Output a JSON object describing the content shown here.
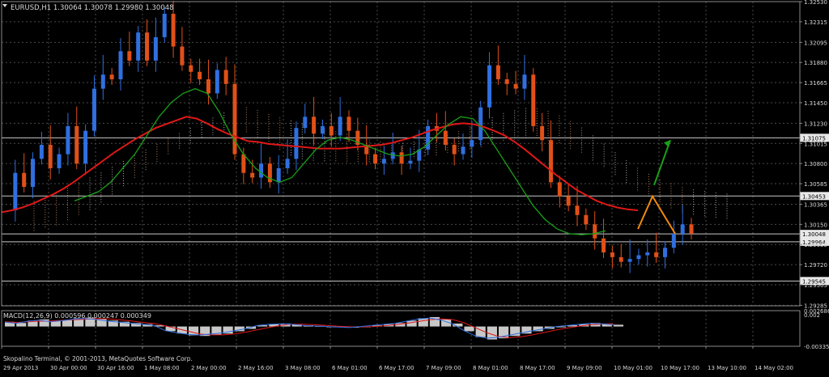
{
  "header": {
    "symbol_info": "EURUSD,H1  1.30064 1.30078 1.29980 1.30048",
    "macd_info": "MACD(12,26,9) 0.000596 0.000247 0.000349",
    "footer": "Skopalino Terminal, © 2001-2013, MetaQuotes Software Corp."
  },
  "colors": {
    "background": "#000000",
    "bull": "#2f6fe0",
    "bear": "#e05018",
    "ma_red": "#e01818",
    "ma_green": "#18a018",
    "cloud_a": "#e8a070",
    "cloud_b": "#d8d8d8",
    "forecast_up": "#18a018",
    "forecast_down": "#f08a10",
    "grid": "#4a4a4a",
    "hline": "#c8c8c8",
    "text": "#d8d8d8"
  },
  "chart_data": [
    {
      "type": "line",
      "name": "EURUSD H1 price",
      "price_axis": {
        "ticks": [
          "1.32530",
          "1.32315",
          "1.32095",
          "1.31880",
          "1.31665",
          "1.31450",
          "1.31230",
          "1.31015",
          "1.30800",
          "1.30585",
          "1.30365",
          "1.30150",
          "1.29935",
          "1.29720",
          "1.29505",
          "1.29285"
        ],
        "ylim": [
          1.2928,
          1.3253
        ]
      },
      "time_axis": {
        "labels": [
          "29 Apr 2013",
          "30 Apr 00:00",
          "30 Apr 16:00",
          "1 May 08:00",
          "2 May 00:00",
          "2 May 16:00",
          "3 May 08:00",
          "6 May 01:00",
          "6 May 17:00",
          "7 May 09:00",
          "8 May 01:00",
          "8 May 17:00",
          "9 May 09:00",
          "10 May 01:00",
          "10 May 17:00",
          "13 May 10:00",
          "14 May 02:00"
        ]
      },
      "horizontal_levels": [
        {
          "value": 1.31075,
          "label": "1.31075"
        },
        {
          "value": 1.30453,
          "label": "1.30453"
        },
        {
          "value": 1.30048,
          "label": "1.30048"
        },
        {
          "value": 1.29964,
          "label": "1.29964"
        },
        {
          "value": 1.29545,
          "label": "1.29545"
        }
      ],
      "close_path": [
        1.303,
        1.307,
        1.3055,
        1.3085,
        1.31,
        1.3075,
        1.309,
        1.312,
        1.308,
        1.3115,
        1.316,
        1.3175,
        1.317,
        1.32,
        1.319,
        1.322,
        1.319,
        1.3215,
        1.324,
        1.3205,
        1.3185,
        1.3178,
        1.317,
        1.3155,
        1.318,
        1.3165,
        1.309,
        1.307,
        1.3065,
        1.308,
        1.306,
        1.3075,
        1.3085,
        1.3118,
        1.313,
        1.3112,
        1.312,
        1.311,
        1.313,
        1.3115,
        1.31,
        1.309,
        1.308,
        1.3085,
        1.3092,
        1.308,
        1.3083,
        1.3095,
        1.312,
        1.3115,
        1.31,
        1.309,
        1.3098,
        1.3105,
        1.314,
        1.3185,
        1.317,
        1.3165,
        1.316,
        1.3175,
        1.312,
        1.3105,
        1.306,
        1.3045,
        1.3035,
        1.3025,
        1.3015,
        1.3,
        1.2985,
        1.298,
        1.2975,
        1.2978,
        1.2982,
        1.2985,
        1.298,
        1.299,
        1.3005,
        1.3015,
        1.3005
      ],
      "series": [
        {
          "name": "red MA",
          "values": [
            1.3028,
            1.303,
            1.3033,
            1.3037,
            1.3042,
            1.3047,
            1.3053,
            1.306,
            1.3068,
            1.3076,
            1.3084,
            1.3092,
            1.3099,
            1.3106,
            1.3112,
            1.3118,
            1.3122,
            1.3126,
            1.313,
            1.3128,
            1.3123,
            1.3117,
            1.3112,
            1.3108,
            1.3104,
            1.3103,
            1.3101,
            1.31,
            1.3099,
            1.3098,
            1.3097,
            1.3096,
            1.3096,
            1.3096,
            1.3097,
            1.3098,
            1.3099,
            1.31,
            1.3102,
            1.3105,
            1.3108,
            1.3112,
            1.3116,
            1.3119,
            1.3122,
            1.3123,
            1.3122,
            1.3119,
            1.3115,
            1.311,
            1.3103,
            1.3095,
            1.3086,
            1.3077,
            1.3068,
            1.306,
            1.3052,
            1.3046,
            1.304,
            1.3036,
            1.3033,
            1.3031,
            1.303
          ]
        },
        {
          "name": "green MA",
          "values": [
            1.304,
            1.3045,
            1.305,
            1.306,
            1.3075,
            1.309,
            1.311,
            1.313,
            1.3145,
            1.3155,
            1.316,
            1.3155,
            1.3135,
            1.311,
            1.309,
            1.3075,
            1.3065,
            1.306,
            1.3065,
            1.308,
            1.3095,
            1.3105,
            1.3108,
            1.3105,
            1.31,
            1.3095,
            1.309,
            1.3088,
            1.309,
            1.3098,
            1.311,
            1.3122,
            1.313,
            1.3128,
            1.3115,
            1.3095,
            1.3075,
            1.3055,
            1.3035,
            1.302,
            1.301,
            1.3005,
            1.3004,
            1.3005,
            1.3008
          ]
        },
        {
          "name": "forecast up",
          "values": [
            1.3057,
            1.3105
          ]
        },
        {
          "name": "forecast down",
          "values": [
            1.301,
            1.3045,
            1.3005
          ]
        }
      ]
    },
    {
      "type": "bar",
      "name": "MACD(12,26,9)",
      "value_axis": {
        "ticks": [
          "0.002686",
          "0.002",
          "-0.003354"
        ],
        "ylim": [
          -0.003354,
          0.002686
        ]
      },
      "values": [
        0.0008,
        0.0006,
        0.001,
        0.0012,
        0.0009,
        0.0011,
        0.0014,
        0.0015,
        0.0013,
        0.001,
        0.0008,
        0.0006,
        0.0004,
        0.0002,
        -0.0008,
        -0.0012,
        -0.0015,
        -0.0016,
        -0.0014,
        -0.0012,
        -0.0008,
        -0.0004,
        0.0002,
        0.0004,
        0.0005,
        0.0004,
        0.0002,
        0.0001,
        0.0,
        -0.0001,
        -0.0002,
        0.0,
        0.0002,
        0.0004,
        0.0006,
        0.001,
        0.0014,
        0.0016,
        0.0012,
        0.0005,
        -0.0008,
        -0.0018,
        -0.0022,
        -0.002,
        -0.0016,
        -0.0012,
        -0.0008,
        -0.0004,
        0.0,
        0.0002,
        0.0004,
        0.0006,
        0.0005,
        0.0003
      ]
    }
  ]
}
